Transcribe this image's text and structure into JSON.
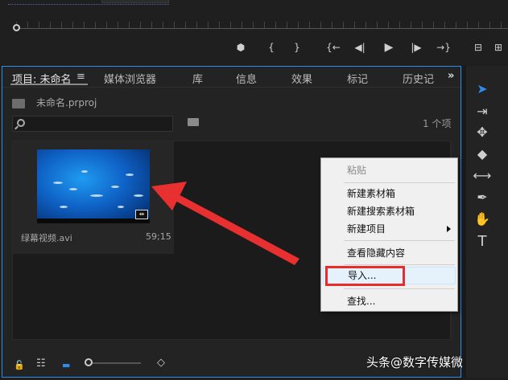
{
  "transport": {
    "marker": "⬢",
    "mark_in": "{",
    "mark_out": "}",
    "go_to_in": "{←",
    "step_back": "◀|",
    "play": "▶",
    "step_forward": "|▶",
    "go_to_out": "→}",
    "lift": "⊟",
    "extract": "⊞"
  },
  "tabs": [
    {
      "label": "项目: 未命名",
      "active": true
    },
    {
      "label": "媒体浏览器",
      "active": false
    },
    {
      "label": "库",
      "active": false
    },
    {
      "label": "信息",
      "active": false
    },
    {
      "label": "效果",
      "active": false
    },
    {
      "label": "标记",
      "active": false
    },
    {
      "label": "历史记",
      "active": false
    }
  ],
  "tab_menu_icon": "≡",
  "tab_overflow_icon": "»",
  "project": {
    "file_name": "未命名.prproj",
    "item_count": "1 个项",
    "search_placeholder": ""
  },
  "clip": {
    "name": "绿幕视频.avi",
    "duration": "59;15",
    "badge": "⇹"
  },
  "context_menu": {
    "items": [
      {
        "label": "粘贴",
        "disabled": true
      },
      {
        "label": "新建素材箱",
        "disabled": false
      },
      {
        "label": "新建搜索素材箱",
        "disabled": false
      },
      {
        "label": "新建项目",
        "disabled": false,
        "submenu": true
      },
      {
        "label": "查看隐藏内容",
        "disabled": false
      },
      {
        "label": "导入...",
        "disabled": false,
        "hover": true
      },
      {
        "label": "查找...",
        "disabled": false
      }
    ]
  },
  "bottom_bar": {
    "lock_icon": "🔓",
    "list_view_icon": "☷",
    "icon_view_icon": "▬",
    "sort_icon": "◇",
    "watermark": "头条@数字传媒微课堂"
  },
  "tools": {
    "selection": "➤",
    "track_select": "⇥",
    "ripple": "✥",
    "razor": "◆",
    "slip": "⟷",
    "pen": "✒",
    "hand": "✋",
    "type": "T"
  },
  "colors": {
    "panel_border": "#2d8ceb",
    "highlight_box": "#e82c2c",
    "arrow": "#e83030"
  }
}
